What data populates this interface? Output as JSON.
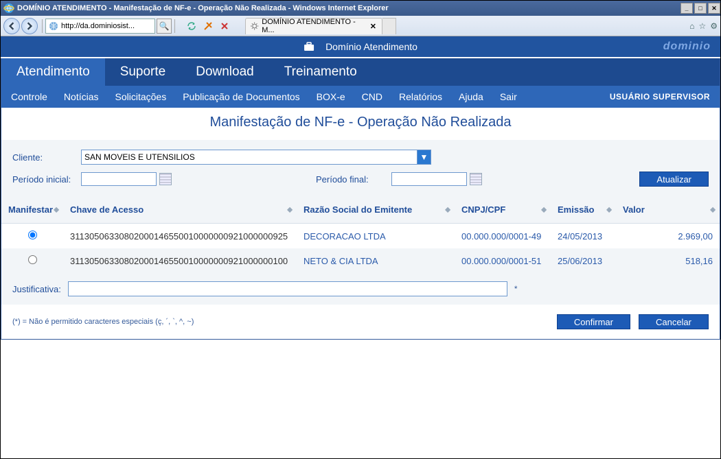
{
  "window": {
    "title": "DOMÍNIO ATENDIMENTO - Manifestação de NF-e - Operação Não Realizada - Windows Internet Explorer"
  },
  "browser": {
    "url_display": "http://da.dominiosist...",
    "search_icon": "🔍",
    "tab_title": "DOMÍNIO ATENDIMENTO - M...",
    "tab_close": "✕"
  },
  "header": {
    "app_name": "Domínio Atendimento",
    "logo": "dominio"
  },
  "primary_nav": [
    "Atendimento",
    "Suporte",
    "Download",
    "Treinamento"
  ],
  "primary_nav_active": 0,
  "secondary_nav": [
    "Controle",
    "Notícias",
    "Solicitações",
    "Publicação de Documentos",
    "BOX-e",
    "CND",
    "Relatórios",
    "Ajuda",
    "Sair"
  ],
  "user_label": "USUÁRIO SUPERVISOR",
  "page_title": "Manifestação de NF-e - Operação Não Realizada",
  "filters": {
    "cliente_label": "Cliente:",
    "cliente_value": "SAN MOVEIS E UTENSILIOS",
    "periodo_inicial_label": "Período inicial:",
    "periodo_inicial_value": "",
    "periodo_final_label": "Período final:",
    "periodo_final_value": "",
    "atualizar_label": "Atualizar"
  },
  "table": {
    "cols": [
      "Manifestar",
      "Chave de Acesso",
      "Razão Social do Emitente",
      "CNPJ/CPF",
      "Emissão",
      "Valor"
    ],
    "rows": [
      {
        "selected": true,
        "chave": "31130506330802000146550010000000921000000925",
        "razao": "DECORACAO LTDA",
        "cnpj": "00.000.000/0001-49",
        "emissao": "24/05/2013",
        "valor": "2.969,00"
      },
      {
        "selected": false,
        "chave": "31130506330802000146550010000000921000000100",
        "razao": "NETO & CIA LTDA",
        "cnpj": "00.000.000/0001-51",
        "emissao": "25/06/2013",
        "valor": "518,16"
      }
    ]
  },
  "justificativa": {
    "label": "Justificativa:",
    "value": "",
    "asterisk": "*"
  },
  "footnote": "(*) = Não é permitido caracteres especiais (ç, ´, `, ^, ~)",
  "buttons": {
    "confirm": "Confirmar",
    "cancel": "Cancelar"
  }
}
